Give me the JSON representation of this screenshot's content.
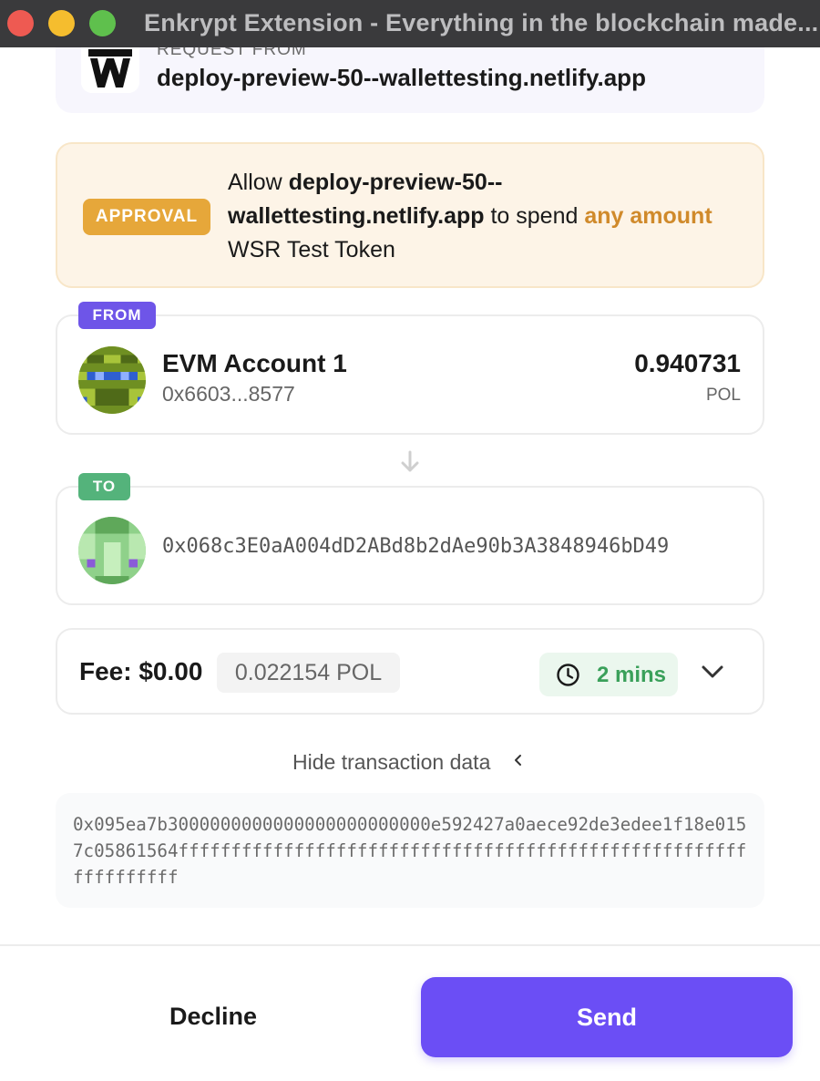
{
  "window": {
    "title": "Enkrypt Extension - Everything in the blockchain made..."
  },
  "request": {
    "label": "REQUEST FROM",
    "site": "deploy-preview-50--wallettesting.netlify.app",
    "logo_icon": "w-logo-icon"
  },
  "approval": {
    "badge": "APPROVAL",
    "prefix": "Allow ",
    "site": "deploy-preview-50--wallettesting.netlify.app",
    "middle": " to spend ",
    "amount": "any amount",
    "token": "WSR Test Token",
    "badge_color": "#e6a73a",
    "amount_color": "#d08a2b"
  },
  "from": {
    "tag": "FROM",
    "name": "EVM Account 1",
    "address": "0x6603...8577",
    "balance": "0.940731",
    "unit": "POL",
    "tag_color": "#6e55e8"
  },
  "to": {
    "tag": "TO",
    "address": "0x068c3E0aA004dD2ABd8b2dAe90b3A3848946bD49",
    "tag_color": "#54b37b"
  },
  "fee": {
    "label": "Fee: $0.00",
    "crypto": "0.022154 POL",
    "time": "2 mins",
    "time_icon": "clock-icon",
    "expand_icon": "chevron-down-icon"
  },
  "tx_data": {
    "toggle_label": "Hide transaction data",
    "toggle_icon": "chevron-left-icon",
    "hex": "0x095ea7b3000000000000000000000000e592427a0aece92de3edee1f18e0157c05861564ffffffffffffffffffffffffffffffffffffffffffffffffffffffffffffffff"
  },
  "actions": {
    "decline": "Decline",
    "send": "Send",
    "send_color": "#6b4ef5"
  }
}
